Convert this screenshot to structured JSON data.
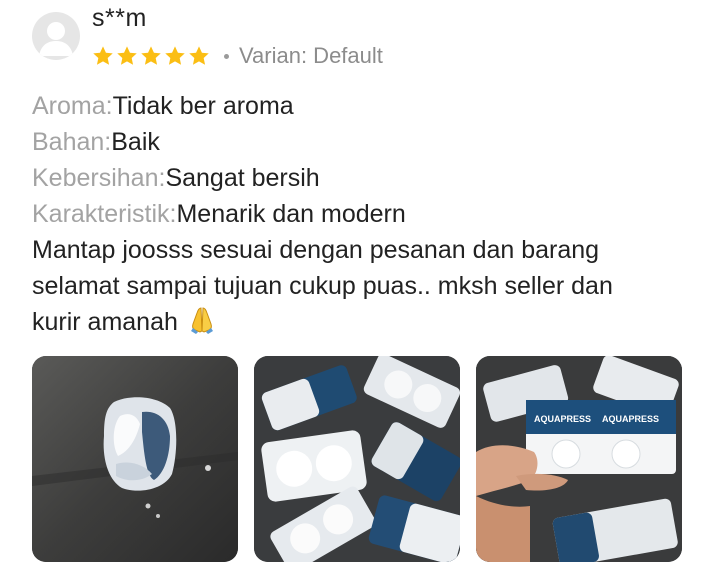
{
  "review": {
    "username": "s**m",
    "rating": 5,
    "rating_max": 5,
    "variant_text": "Varian: Default",
    "attributes": [
      {
        "label": "Aroma:",
        "value": "Tidak ber aroma"
      },
      {
        "label": "Bahan:",
        "value": "Baik"
      },
      {
        "label": "Kebersihan:",
        "value": "Sangat bersih"
      },
      {
        "label": "Karakteristik:",
        "value": "Menarik dan modern"
      }
    ],
    "comment_lines": [
      "Mantap joosss sesuai dengan pesanan dan barang",
      "selamat sampai tujuan cukup puas.. mksh seller dan",
      "kurir amanah"
    ],
    "comment_emoji_icon": "folded-hands-icon",
    "photo_brand_labels": [
      "AQUAPRESS",
      "AQUAPRESS"
    ]
  },
  "colors": {
    "star": "#FBBE14",
    "label_gray": "#A3A3A3",
    "text": "#222222",
    "variant_gray": "#8C8C8C",
    "avatar_bg": "#E6E6E6"
  },
  "icons": {
    "avatar": "user-avatar-icon",
    "star": "star-icon",
    "separator": "dot-separator"
  }
}
